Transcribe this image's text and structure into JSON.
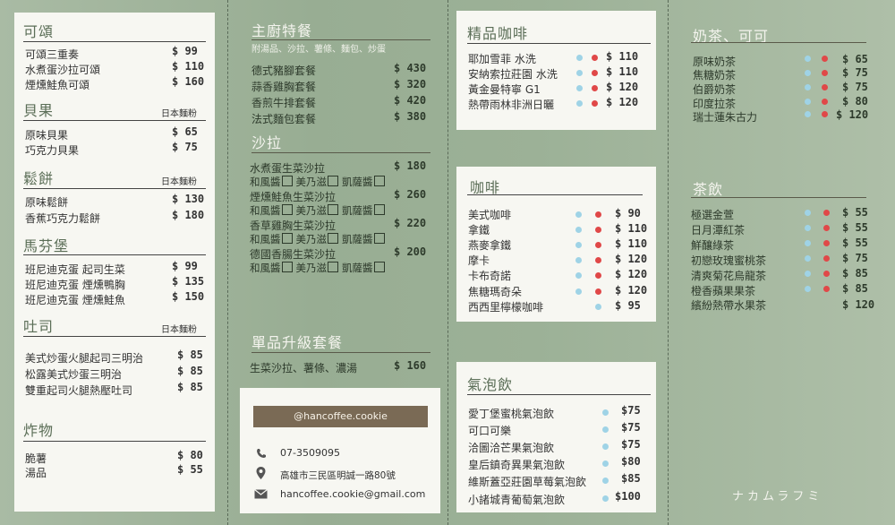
{
  "col1": {
    "sections": [
      {
        "title": "可頌",
        "tag": "",
        "items": [
          {
            "name": "可頌三重奏",
            "price": "$ 99"
          },
          {
            "name": "水煮蛋沙拉可頌",
            "price": "$ 110"
          },
          {
            "name": "煙燻鮭魚可頌",
            "price": "$ 160"
          }
        ]
      },
      {
        "title": "貝果",
        "tag": "日本麵粉",
        "items": [
          {
            "name": "原味貝果",
            "price": "$ 65"
          },
          {
            "name": "巧克力貝果",
            "price": "$ 75"
          }
        ]
      },
      {
        "title": "鬆餅",
        "tag": "日本麵粉",
        "items": [
          {
            "name": "原味鬆餅",
            "price": "$ 130"
          },
          {
            "name": "香蕉巧克力鬆餅",
            "price": "$ 180"
          }
        ]
      },
      {
        "title": "馬芬堡",
        "tag": "",
        "items": [
          {
            "name": "班尼迪克蛋 起司生菜",
            "price": "$ 99"
          },
          {
            "name": "班尼迪克蛋 煙燻鴨胸",
            "price": "$ 135"
          },
          {
            "name": "班尼迪克蛋 煙燻鮭魚",
            "price": "$ 150"
          }
        ]
      },
      {
        "title": "吐司",
        "tag": "日本麵粉",
        "items": [
          {
            "name": "美式炒蛋火腿起司三明治",
            "price": "$ 85"
          },
          {
            "name": "松露美式炒蛋三明治",
            "price": "$ 85"
          },
          {
            "name": "雙重起司火腿熱壓吐司",
            "price": "$ 85"
          }
        ]
      },
      {
        "title": "炸物",
        "tag": "",
        "items": [
          {
            "name": "脆薯",
            "price": "$ 80"
          },
          {
            "name": "湯品",
            "price": "$ 55"
          }
        ]
      }
    ]
  },
  "col2": {
    "chef": {
      "title": "主廚特餐",
      "subtitle": "附湯品、沙拉、薯條、麵包、炒蛋",
      "items": [
        {
          "name": "德式豬腳套餐",
          "price": "$ 430"
        },
        {
          "name": "蒜香雞胸套餐",
          "price": "$ 320"
        },
        {
          "name": "香煎牛排套餐",
          "price": "$ 420"
        },
        {
          "name": "法式麵包套餐",
          "price": "$ 380"
        }
      ]
    },
    "salad": {
      "title": "沙拉",
      "items": [
        {
          "name": "水煮蛋生菜沙拉",
          "price": "$ 180"
        },
        {
          "name": "煙燻鮭魚生菜沙拉",
          "price": "$ 260"
        },
        {
          "name": "香草雞胸生菜沙拉",
          "price": "$ 220"
        },
        {
          "name": "德國香腸生菜沙拉",
          "price": "$ 200"
        }
      ],
      "options": [
        "和風醬",
        "美乃滋",
        "凱薩醬"
      ]
    },
    "upgrade": {
      "title": "單品升級套餐",
      "item": "生菜沙拉、薯條、濃湯",
      "price": "$ 160"
    },
    "contact": {
      "handle": "@hancoffee.cookie",
      "phone": "07-3509095",
      "address": "高雄市三民區明誠一路80號",
      "email": "hancoffee.cookie@gmail.com"
    }
  },
  "col3": {
    "premium": {
      "title": "精品咖啡",
      "items": [
        {
          "name": "耶加雪菲 水洗",
          "price": "$ 110",
          "ice": true,
          "hot": true
        },
        {
          "name": "安納索拉莊園 水洗",
          "price": "$ 110",
          "ice": true,
          "hot": true
        },
        {
          "name": "黃金曼特寧 G1",
          "price": "$ 120",
          "ice": true,
          "hot": true
        },
        {
          "name": "熱帶雨林非洲日曬",
          "price": "$ 120",
          "ice": true,
          "hot": true
        }
      ]
    },
    "coffee": {
      "title": "咖啡",
      "items": [
        {
          "name": "美式咖啡",
          "price": "$ 90",
          "ice": true,
          "hot": true
        },
        {
          "name": "拿鐵",
          "price": "$ 110",
          "ice": true,
          "hot": true
        },
        {
          "name": "燕麥拿鐵",
          "price": "$ 110",
          "ice": true,
          "hot": true
        },
        {
          "name": "摩卡",
          "price": "$ 120",
          "ice": true,
          "hot": true
        },
        {
          "name": "卡布奇諾",
          "price": "$ 120",
          "ice": true,
          "hot": true
        },
        {
          "name": "焦糖瑪奇朵",
          "price": "$ 120",
          "ice": true,
          "hot": true
        },
        {
          "name": "西西里檸檬咖啡",
          "price": "$ 95",
          "ice": true,
          "hot": false
        }
      ]
    },
    "sparkling": {
      "title": "氣泡飲",
      "items": [
        {
          "name": "愛丁堡蜜桃氣泡飲",
          "price": "$75"
        },
        {
          "name": "可口可樂",
          "price": "$75"
        },
        {
          "name": "洽圖洽芒果氣泡飲",
          "price": "$75"
        },
        {
          "name": "皇后鎮奇異果氣泡飲",
          "price": "$80"
        },
        {
          "name": "維斯蓋亞莊園草莓氣泡飲",
          "price": "$85"
        },
        {
          "name": "小諸城青葡萄氣泡飲",
          "price": "$100"
        }
      ]
    }
  },
  "col4": {
    "milktea": {
      "title": "奶茶、可可",
      "items": [
        {
          "name": "原味奶茶",
          "price": "$ 65",
          "ice": true,
          "hot": true
        },
        {
          "name": "焦糖奶茶",
          "price": "$ 75",
          "ice": true,
          "hot": true
        },
        {
          "name": "伯爵奶茶",
          "price": "$ 75",
          "ice": true,
          "hot": true
        },
        {
          "name": "印度拉茶",
          "price": "$ 80",
          "ice": true,
          "hot": true
        },
        {
          "name": "瑞士蓮朱古力",
          "price": "$ 120",
          "ice": true,
          "hot": true
        }
      ]
    },
    "tea": {
      "title": "茶飲",
      "items": [
        {
          "name": "極選金萱",
          "price": "$ 55",
          "ice": true,
          "hot": true
        },
        {
          "name": "日月潭紅茶",
          "price": "$ 55",
          "ice": true,
          "hot": true
        },
        {
          "name": "鮮釀綠茶",
          "price": "$ 55",
          "ice": true,
          "hot": true
        },
        {
          "name": "初戀玫瑰蜜桃茶",
          "price": "$ 75",
          "ice": true,
          "hot": true
        },
        {
          "name": "清爽菊花烏龍茶",
          "price": "$ 85",
          "ice": true,
          "hot": true
        },
        {
          "name": "橙香蘋果果茶",
          "price": "$ 85",
          "ice": true,
          "hot": true
        },
        {
          "name": "繽紛熱帶水果茶",
          "price": "$ 120",
          "ice": false,
          "hot": false
        }
      ]
    },
    "signature": "ナカムラフミ"
  },
  "colors": {
    "hot": "#e04848",
    "ice": "#9fd3e6",
    "accent": "#5b6e57",
    "banner": "#7a6a55"
  }
}
